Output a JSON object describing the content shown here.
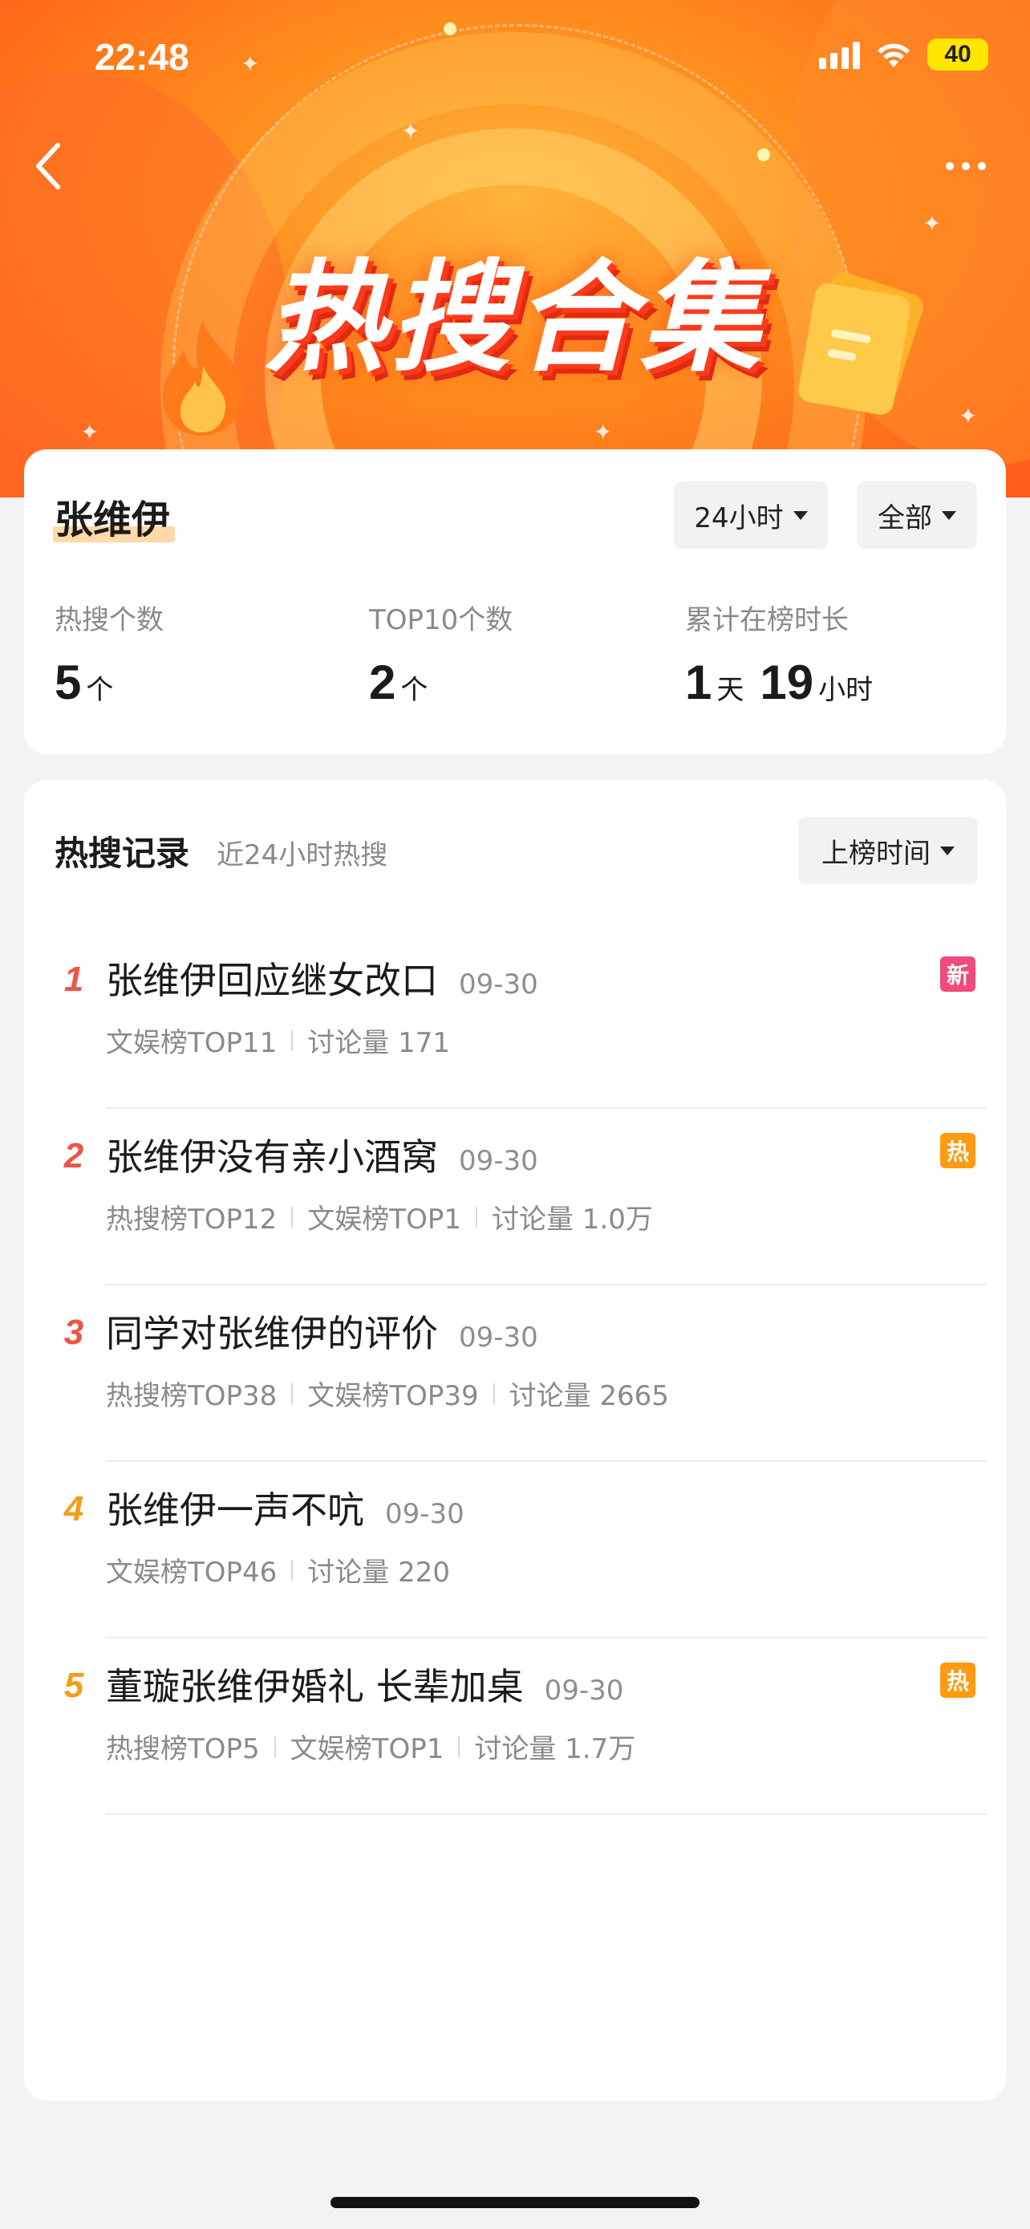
{
  "status_bar": {
    "time": "22:48",
    "battery": "40"
  },
  "banner": {
    "title": "热搜合集"
  },
  "summary": {
    "name": "张维伊",
    "time_filter": "24小时",
    "scope_filter": "全部",
    "stats": [
      {
        "label": "热搜个数",
        "value": "5",
        "unit": "个"
      },
      {
        "label": "TOP10个数",
        "value": "2",
        "unit": "个"
      },
      {
        "label": "累计在榜时长",
        "value_days": "1",
        "unit_days": "天",
        "value_hours": "19",
        "unit_hours": "小时"
      }
    ]
  },
  "records": {
    "title": "热搜记录",
    "subtitle": "近24小时热搜",
    "sort_label": "上榜时间",
    "items": [
      {
        "rank": "1",
        "title": "张维伊回应继女改口",
        "date": "09-30",
        "meta": [
          "文娱榜TOP11",
          "讨论量 171"
        ],
        "badge": "新"
      },
      {
        "rank": "2",
        "title": "张维伊没有亲小酒窝",
        "date": "09-30",
        "meta": [
          "热搜榜TOP12",
          "文娱榜TOP1",
          "讨论量 1.0万"
        ],
        "badge": "热"
      },
      {
        "rank": "3",
        "title": "同学对张维伊的评价",
        "date": "09-30",
        "meta": [
          "热搜榜TOP38",
          "文娱榜TOP39",
          "讨论量 2665"
        ],
        "badge": ""
      },
      {
        "rank": "4",
        "title": "张维伊一声不吭",
        "date": "09-30",
        "meta": [
          "文娱榜TOP46",
          "讨论量 220"
        ],
        "badge": ""
      },
      {
        "rank": "5",
        "title": "董璇张维伊婚礼 长辈加桌",
        "date": "09-30",
        "meta": [
          "热搜榜TOP5",
          "文娱榜TOP1",
          "讨论量 1.7万"
        ],
        "badge": "热"
      }
    ]
  },
  "colors": {
    "rank_top": "#ee5544",
    "rank_other": "#f59d1a",
    "badge_new": "#f04b7a",
    "badge_hot": "#ff9a12"
  },
  "icons": {
    "back": "chevron-left-icon",
    "more": "more-dots-icon",
    "wifi": "wifi-icon",
    "signal": "signal-icon",
    "caret": "caret-down-icon"
  }
}
